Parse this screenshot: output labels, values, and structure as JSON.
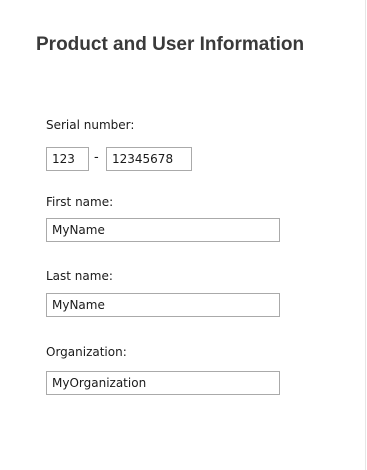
{
  "header": {
    "title": "Product and User Information"
  },
  "form": {
    "serial": {
      "label": "Serial number:",
      "part1": "123",
      "separator": "-",
      "part2": "12345678"
    },
    "first_name": {
      "label": "First name:",
      "value": "MyName"
    },
    "last_name": {
      "label": "Last name:",
      "value": "MyName"
    },
    "organization": {
      "label": "Organization:",
      "value": "MyOrganization"
    }
  }
}
